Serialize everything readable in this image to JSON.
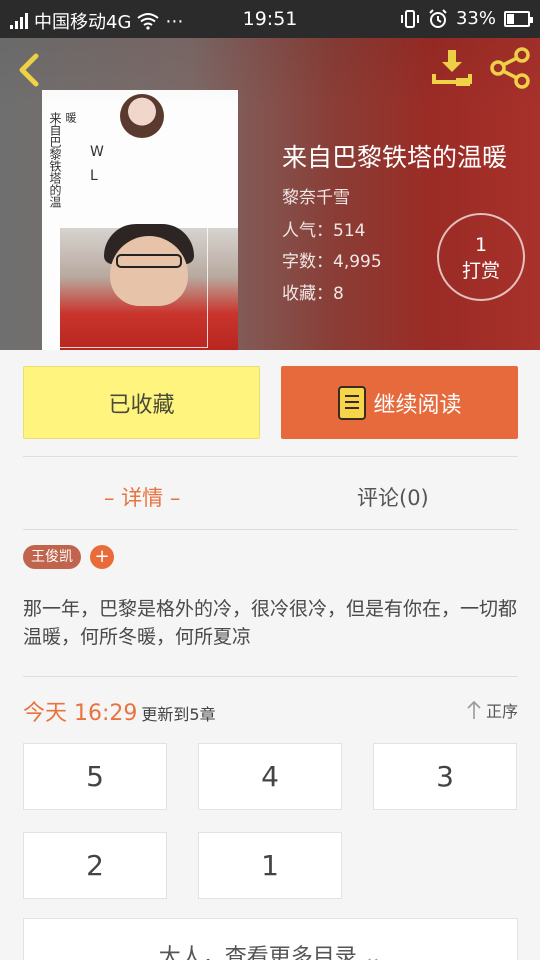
{
  "status_bar": {
    "carrier": "中国移动4G",
    "time": "19:51",
    "battery": "33%",
    "battery_level": 0.33
  },
  "book": {
    "title": "来自巴黎铁塔的温暖",
    "author": "黎奈千雪",
    "popularity_label": "人气：",
    "popularity": "514",
    "words_label": "字数：",
    "words": "4,995",
    "favorites_label": "收藏：",
    "favorites": "8",
    "tip_count": "1",
    "tip_label": "打赏",
    "cover_text": [
      "来",
      "自",
      "巴",
      "黎",
      "铁",
      "塔",
      "的",
      "温"
    ],
    "cover_side": "暖",
    "cover_letters": "W L"
  },
  "actions": {
    "favorited_label": "已收藏",
    "continue_label": "继续阅读"
  },
  "tabs": {
    "detail": "– 详情 –",
    "comment": "评论(0)"
  },
  "tags": {
    "tag1": "王俊凯",
    "add": "+"
  },
  "description": "那一年，巴黎是格外的冷，很冷很冷，但是有你在，一切都温暖，何所冬暖，何所夏凉",
  "update": {
    "time": "今天 16:29",
    "text": "更新到5章",
    "order": "正序"
  },
  "chapters": [
    "5",
    "4",
    "3",
    "2",
    "1"
  ],
  "more": {
    "label": "大人，查看更多目录"
  },
  "colors": {
    "accent": "#e8733f",
    "read_button": "#e66a3b",
    "fav_button": "#fff57e",
    "icon_yellow": "#f5d64a"
  }
}
